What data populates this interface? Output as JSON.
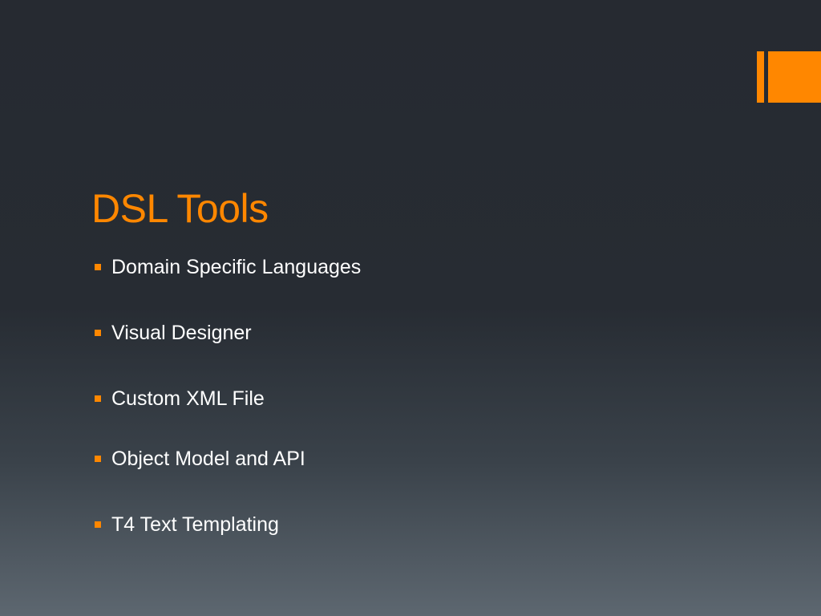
{
  "slide": {
    "title": "DSL Tools",
    "bullets": [
      "Domain Specific Languages",
      "Visual Designer",
      "Custom XML File",
      "Object Model and API",
      "T4 Text Templating"
    ]
  },
  "colors": {
    "accent": "#ff8700",
    "text": "#ffffff",
    "background_top": "#262a31",
    "background_bottom": "#5d6770"
  }
}
